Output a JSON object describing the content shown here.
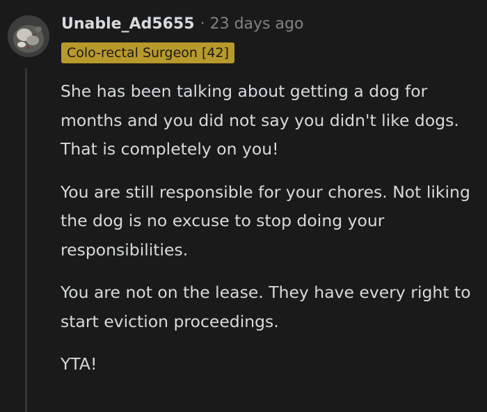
{
  "comment": {
    "username": "Unable_Ad5655",
    "separator": "·",
    "timestamp": "23 days ago",
    "flair": "Colo-rectal Surgeon [42]",
    "paragraphs": [
      "She has been talking about getting a dog for months and you did not say you didn't like dogs. That is completely on you!",
      "You are still responsible for your chores. Not liking the dog is no excuse to stop doing your responsibilities.",
      "You are not on the lease. They have every right to start eviction proceedings.",
      "YTA!"
    ]
  },
  "colors": {
    "background": "#1a1a1b",
    "text": "#d7dadc",
    "muted": "#818384",
    "flair_background": "#b8992b",
    "thread_line": "#343536"
  },
  "icons": {
    "avatar": "user-avatar-image"
  }
}
